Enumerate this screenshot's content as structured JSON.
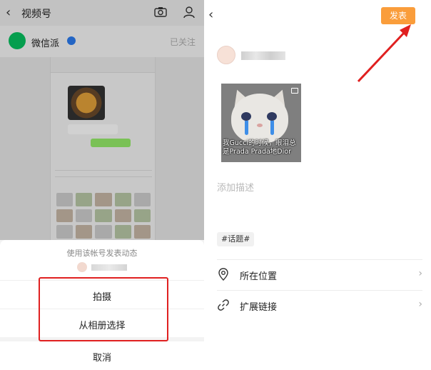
{
  "left": {
    "header": {
      "back_icon": "chevron-left-icon",
      "title": "视频号",
      "camera_icon": "camera-icon",
      "profile_icon": "person-icon"
    },
    "account": {
      "name": "微信派",
      "follow_status": "已关注"
    },
    "sheet": {
      "hint": "使用该帐号发表动态",
      "options": [
        "拍摄",
        "从相册选择"
      ],
      "cancel": "取消"
    },
    "highlight_color": "#e02020"
  },
  "right": {
    "header": {
      "back_icon": "chevron-left-icon",
      "publish_label": "发表",
      "publish_color": "#fa9d3b"
    },
    "media": {
      "caption": "我Gucci的时候，眼泪总是Prada Prada地Dior"
    },
    "description_placeholder": "添加描述",
    "topic_tag": "#话题#",
    "rows": [
      {
        "icon": "location-pin-icon",
        "label": "所在位置"
      },
      {
        "icon": "link-icon",
        "label": "扩展链接"
      }
    ],
    "arrow_color": "#e02020"
  }
}
